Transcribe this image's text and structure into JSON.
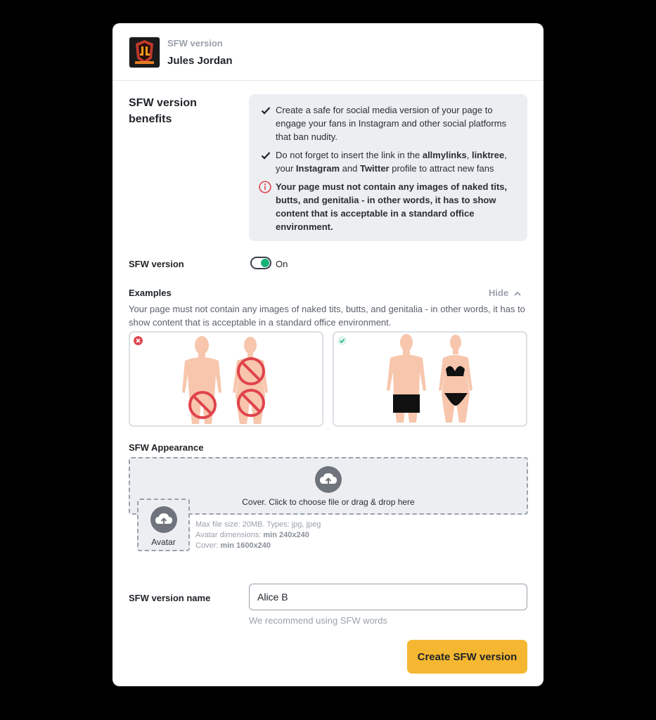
{
  "header": {
    "subtitle": "SFW version",
    "title": "Jules Jordan"
  },
  "benefits": {
    "title": "SFW version benefits",
    "item1": "Create a safe for social media version of your page to engage your fans in Instagram and other social platforms that ban nudity.",
    "item2_parts": [
      "Do not forget to insert the link in the ",
      "allmylinks",
      ", ",
      "linktree",
      ", your ",
      "Instagram",
      " and ",
      "Twitter",
      " profile to attract new fans"
    ],
    "warning": "Your page must not contain any images of naked tits, butts, and genitalia - in other words, it has to show content that is acceptable in a standard office environment."
  },
  "sfw_toggle": {
    "label": "SFW version",
    "state": "On"
  },
  "examples": {
    "label": "Examples",
    "hide_label": "Hide",
    "text": "Your page must not contain any images of naked tits, butts, and genitalia - in other words, it has to show content that is acceptable in a standard office environment."
  },
  "appearance": {
    "label": "SFW Appearance",
    "cover_text": "Cover. Click to choose file or drag & drop here",
    "avatar_text": "Avatar",
    "info_line1": "Max file size: 20MB. Types: jpg, jpeg",
    "avatar_dim_label": "Avatar dimensions: ",
    "avatar_dim_value": "min 240x240",
    "cover_dim_label": "Cover: ",
    "cover_dim_value": "min 1600x240"
  },
  "name_field": {
    "label": "SFW version name",
    "value": "Alice B",
    "hint": "We recommend using SFW words"
  },
  "create_button": "Create SFW version",
  "colors": {
    "accent": "#f5b731",
    "toggle_on": "#17b27a",
    "error": "#e0434b",
    "ok": "#17b27a",
    "panel": "#eceef2"
  },
  "icons": [
    "logo-image",
    "check-icon",
    "info-icon",
    "chevron-up-icon",
    "error-badge-icon",
    "ok-badge-icon",
    "upload-cloud-icon"
  ]
}
